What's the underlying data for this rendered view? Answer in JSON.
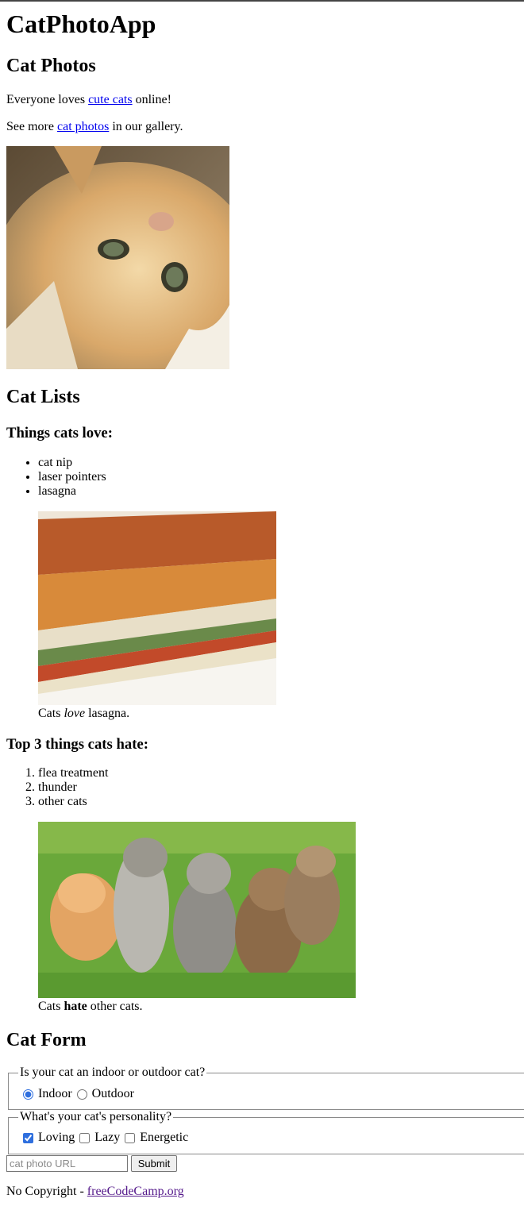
{
  "header": {
    "title": "CatPhotoApp"
  },
  "photos": {
    "heading": "Cat Photos",
    "p1": {
      "before": "Everyone loves ",
      "link": "cute cats",
      "after": " online!"
    },
    "p2": {
      "before": "See more ",
      "link": "cat photos",
      "after": " in our gallery."
    },
    "image_alt": "A cute orange cat lying on its back."
  },
  "lists": {
    "heading": "Cat Lists",
    "love_heading": "Things cats love:",
    "love_items": [
      "cat nip",
      "laser pointers",
      "lasagna"
    ],
    "lasagna_alt": "A slice of lasagna on a plate.",
    "lasagna_caption": {
      "before": "Cats ",
      "em": "love",
      "after": " lasagna."
    },
    "hate_heading": "Top 3 things cats hate:",
    "hate_items": [
      "flea treatment",
      "thunder",
      "other cats"
    ],
    "kittens_alt": "Five cats looking around a field.",
    "kittens_caption": {
      "before": "Cats ",
      "strong": "hate",
      "after": " other cats."
    }
  },
  "form": {
    "heading": "Cat Form",
    "location_legend": "Is your cat an indoor or outdoor cat?",
    "location_options": [
      {
        "label": "Indoor",
        "checked": true
      },
      {
        "label": "Outdoor",
        "checked": false
      }
    ],
    "personality_legend": "What's your cat's personality?",
    "personality_options": [
      {
        "label": "Loving",
        "checked": true
      },
      {
        "label": "Lazy",
        "checked": false
      },
      {
        "label": "Energetic",
        "checked": false
      }
    ],
    "url_placeholder": "cat photo URL",
    "submit_label": "Submit"
  },
  "footer": {
    "before": "No Copyright - ",
    "link": "freeCodeCamp.org"
  },
  "colors": {
    "link": "#0000ee",
    "visited_link": "#551a8b",
    "checkbox_accent": "#2f6fde"
  }
}
